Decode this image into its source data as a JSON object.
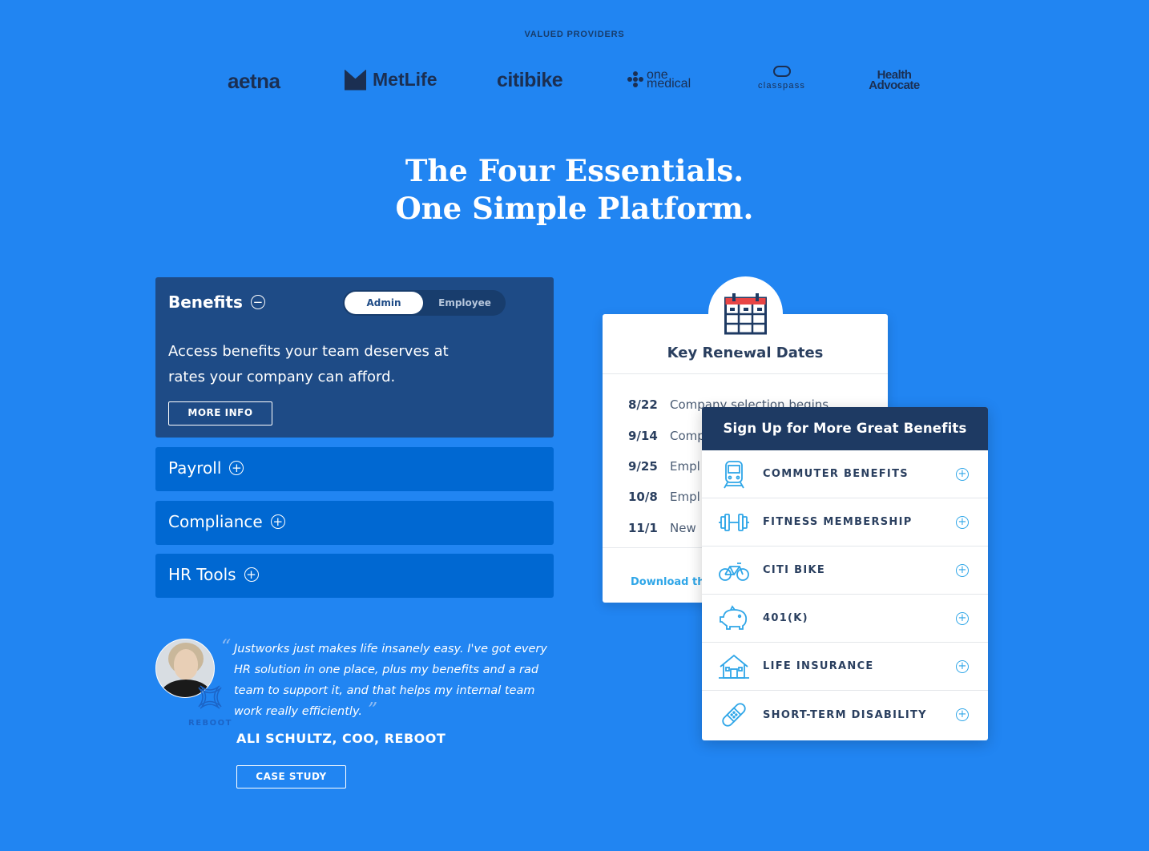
{
  "providers": {
    "label": "VALUED PROVIDERS",
    "logos": [
      "aetna",
      "MetLife",
      "citibike",
      "one medical",
      "classpass",
      "Health Advocate"
    ]
  },
  "headline": {
    "line1": "The Four Essentials.",
    "line2": "One Simple Platform."
  },
  "accordion": {
    "benefits": {
      "title": "Benefits",
      "toggle_admin": "Admin",
      "toggle_employee": "Employee",
      "description": "Access benefits your team deserves at rates your company can afford.",
      "button": "MORE INFO"
    },
    "payroll": "Payroll",
    "compliance": "Compliance",
    "hr_tools": "HR Tools"
  },
  "testimonial": {
    "quote": "Justworks just makes life insanely easy. I've got every HR solution in one place, plus my benefits and a rad team to support it, and that helps my internal team work really efficiently.",
    "author": "ALI SCHULTZ, COO, REBOOT",
    "company_logo": "REBOOT",
    "button": "CASE STUDY"
  },
  "renewal": {
    "title": "Key Renewal Dates",
    "dates": [
      {
        "date": "8/22",
        "text": "Company selection begins"
      },
      {
        "date": "9/14",
        "text": "Comp"
      },
      {
        "date": "9/25",
        "text": "Empl"
      },
      {
        "date": "10/8",
        "text": "Empl"
      },
      {
        "date": "11/1",
        "text": "New"
      }
    ],
    "link": "Download th"
  },
  "signup": {
    "title": "Sign Up for More Great Benefits",
    "items": [
      {
        "label": "COMMUTER BENEFITS",
        "icon": "train-icon"
      },
      {
        "label": "FITNESS MEMBERSHIP",
        "icon": "dumbbell-icon"
      },
      {
        "label": "CITI BIKE",
        "icon": "bike-icon"
      },
      {
        "label": "401(K)",
        "icon": "piggy-bank-icon"
      },
      {
        "label": "LIFE INSURANCE",
        "icon": "house-icon"
      },
      {
        "label": "SHORT-TERM DISABILITY",
        "icon": "bandage-icon"
      }
    ]
  },
  "colors": {
    "background": "#2185f2",
    "accordion_open": "#1e4b86",
    "accordion_closed": "#0068d2",
    "navy": "#1e3a63",
    "accent": "#2fa6e8"
  }
}
